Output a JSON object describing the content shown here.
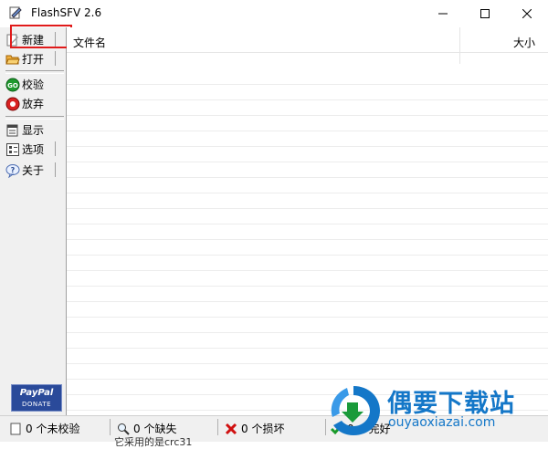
{
  "window": {
    "title": "FlashSFV 2.6",
    "icons": {
      "app": "flashsfv-app-icon",
      "minimize": "minimize-icon",
      "maximize": "maximize-icon",
      "close": "close-icon"
    }
  },
  "toolbar": {
    "items": [
      {
        "label": "新建",
        "icon": "new-icon"
      },
      {
        "label": "打开",
        "icon": "open-folder-icon"
      },
      {
        "label": "校验",
        "icon": "go-icon"
      },
      {
        "label": "放弃",
        "icon": "stop-icon"
      },
      {
        "label": "显示",
        "icon": "display-icon"
      },
      {
        "label": "选项",
        "icon": "options-icon"
      },
      {
        "label": "关于",
        "icon": "help-icon"
      }
    ],
    "donate": {
      "brand": "PayPal",
      "caption": "DONATE"
    }
  },
  "file_list": {
    "columns": [
      {
        "label": "文件名"
      },
      {
        "label": "大小"
      }
    ],
    "rows": []
  },
  "statusbar": {
    "items": [
      {
        "text": "0 个未校验",
        "icon": "unverified-icon"
      },
      {
        "text": "0 个缺失",
        "icon": "search-icon"
      },
      {
        "text": "0 个损坏",
        "icon": "broken-x-icon"
      },
      {
        "text": "0 个完好",
        "icon": "ok-check-icon"
      }
    ],
    "subtext": "它采用的是crc31"
  },
  "watermark": {
    "title": "偶要下载站",
    "url": "ouyaoxiazai.com"
  },
  "colors": {
    "highlight": "#e01a1a",
    "watermark": "#1477c8",
    "paypal": "#2a4a9a"
  }
}
